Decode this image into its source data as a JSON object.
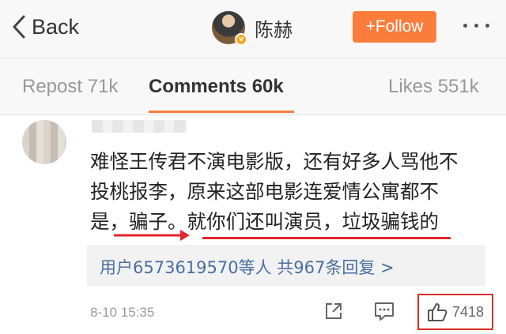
{
  "nav": {
    "back_label": "Back",
    "user_name": "陈赫",
    "follow_label": "+Follow",
    "accent_color": "#fa7d3c"
  },
  "tabs": [
    {
      "label": "Repost 71k",
      "active": false
    },
    {
      "label": "Comments 60k",
      "active": true
    },
    {
      "label": "Likes 551k",
      "active": false
    }
  ],
  "comment": {
    "lines": [
      "难怪王传君不演电影版，还有好多人骂他不",
      "投桃报李，原来这部电影连爱情公寓都不",
      "是，骗子。就你们还叫演员，垃圾骗钱的"
    ],
    "reply_summary": "用户6573619570等人  共967条回复 >",
    "timestamp": "8-10 15:35",
    "like_count": "7418",
    "highlight_color": "#e3262b"
  },
  "icons": {
    "back": "chevron-left-icon",
    "share": "share-icon",
    "reply": "comment-icon",
    "like": "thumbs-up-icon",
    "more": "more-dots-icon"
  }
}
